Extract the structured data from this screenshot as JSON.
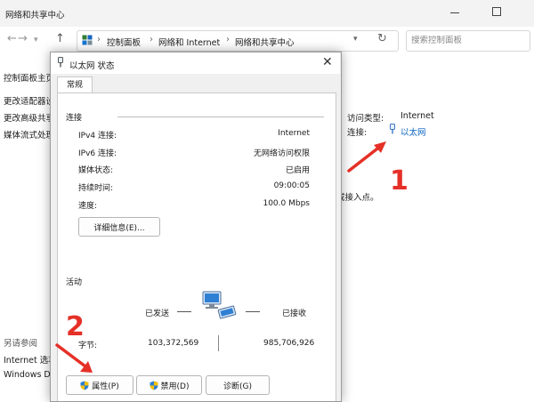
{
  "window": {
    "title": "网络和共享中心"
  },
  "address": {
    "breadcrumbs": [
      "控制面板",
      "网络和 Internet",
      "网络和共享中心"
    ],
    "search_placeholder": "搜索控制面板"
  },
  "sidebar": {
    "items": [
      "控制面板主页",
      "更改适配器设",
      "更改高级共享",
      "媒体流式处理"
    ],
    "see_also_title": "另请参阅",
    "see_also": [
      "Internet 选项",
      "Windows De"
    ]
  },
  "main": {
    "access_type_label": "访问类型:",
    "access_type_value": "Internet",
    "connection_label": "连接:",
    "connection_value": "以太网",
    "fragment": "或接入点。"
  },
  "dialog": {
    "title": "以太网 状态",
    "tab": "常规",
    "connection_section": "连接",
    "rows": [
      {
        "label": "IPv4 连接:",
        "value": "Internet"
      },
      {
        "label": "IPv6 连接:",
        "value": "无网络访问权限"
      },
      {
        "label": "媒体状态:",
        "value": "已启用"
      },
      {
        "label": "持续时间:",
        "value": "09:00:05"
      },
      {
        "label": "速度:",
        "value": "100.0 Mbps"
      }
    ],
    "details_button": "详细信息(E)...",
    "activity_section": "活动",
    "sent_label": "已发送",
    "received_label": "已接收",
    "bytes_label": "字节:",
    "bytes_sent": "103,372,569",
    "bytes_received": "985,706,926",
    "buttons": {
      "properties": "属性(P)",
      "disable": "禁用(D)",
      "diagnose": "诊断(G)"
    }
  },
  "annotations": {
    "step1": "1",
    "step2": "2",
    "color": "#e53027"
  }
}
